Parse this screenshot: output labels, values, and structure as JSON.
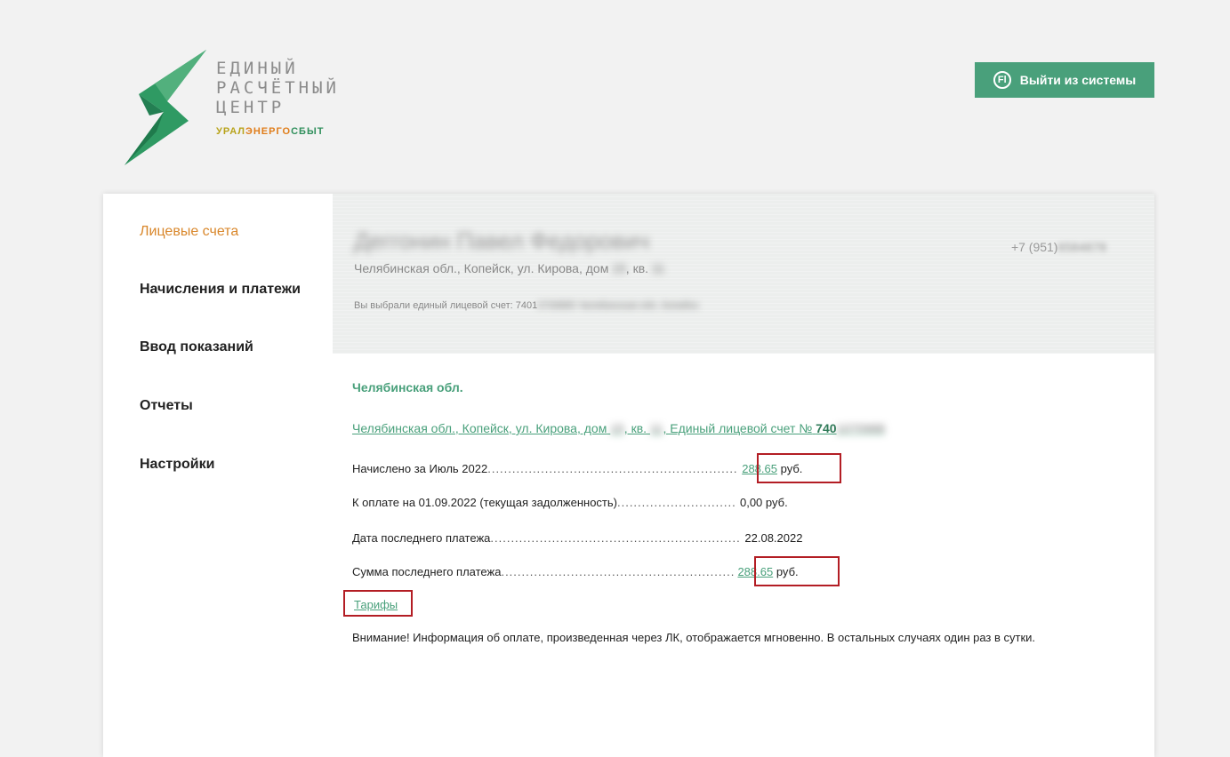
{
  "logo": {
    "lines": [
      "ЕДИНЫЙ",
      "РАСЧЁТНЫЙ",
      "ЦЕНТР"
    ],
    "brand_a": "УРАЛ",
    "brand_b": "ЭНЕРГО",
    "brand_c": "СБЫТ",
    "color_primary": "#2f8f5b",
    "icon": "lightning-bolt-logo"
  },
  "header": {
    "logout_label": "Выйти из системы",
    "logout_icon_letter": "Fl",
    "accent_color": "#49a07b"
  },
  "sidebar": {
    "items": [
      {
        "label": "Лицевые счета",
        "active": true
      },
      {
        "label": "Начисления и платежи",
        "active": false
      },
      {
        "label": "Ввод показаний",
        "active": false
      },
      {
        "label": "Отчеты",
        "active": false
      },
      {
        "label": "Настройки",
        "active": false
      }
    ]
  },
  "profile": {
    "name_hidden": "Деггонин Павел Федорович",
    "phone_prefix": "+7 (951)",
    "phone_hidden": "6584878",
    "address_prefix": "Челябинская обл., Копейск, ул. Кирова, дом",
    "address_house": "15",
    "address_kv_label": ", кв.",
    "address_kv": "11",
    "selected_prefix": "Вы выбрали единый лицевой счет: 7401",
    "selected_hidden": "0709885 Челябинская обл. Копейск"
  },
  "account": {
    "region": "Челябинская обл.",
    "link_prefix": "Челябинская обл., Копейск, ул. Кирова, дом",
    "link_house": "15",
    "link_kv_label": ", кв.",
    "link_kv": "11",
    "link_middle": ", Единый лицевой счет №",
    "link_number_prefix": "740",
    "link_number_hidden": "1070988"
  },
  "rows": [
    {
      "label": "Начислено за Июль 2022",
      "value": "288.65",
      "unit": "руб.",
      "link": true
    },
    {
      "label": "К оплате на 01.09.2022 (текущая задолженность)",
      "value": "0,00 руб.",
      "unit": "",
      "link": false
    },
    {
      "label": "Дата последнего платежа",
      "value": "22.08.2022",
      "unit": "",
      "link": false
    },
    {
      "label": "Сумма последнего платежа",
      "value": "288.65",
      "unit": "руб.",
      "link": true
    }
  ],
  "tariffs_label": "Тарифы",
  "notice": "Внимание! Информация об оплате, произведенная через ЛК, отображается мгновенно. В остальных случаях один раз в сутки.",
  "highlight_color": "#b31d24"
}
